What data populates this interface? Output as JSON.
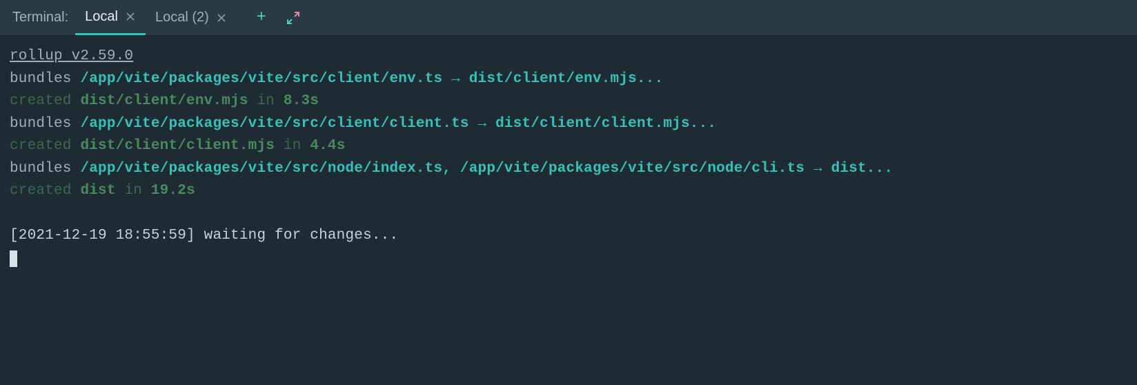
{
  "panel_label": "Terminal:",
  "tabs": [
    {
      "label": "Local",
      "active": true
    },
    {
      "label": "Local (2)",
      "active": false
    }
  ],
  "output": {
    "header": "rollup v2.59.0",
    "lines": [
      {
        "word": "bundles",
        "path": "/app/vite/packages/vite/src/client/env.ts → dist/client/env.mjs..."
      },
      {
        "created_word": "created",
        "out": "dist/client/env.mjs",
        "in_word": " in ",
        "time": "8.3s"
      },
      {
        "word": "bundles",
        "path": "/app/vite/packages/vite/src/client/client.ts → dist/client/client.mjs..."
      },
      {
        "created_word": "created",
        "out": "dist/client/client.mjs",
        "in_word": " in ",
        "time": "4.4s"
      },
      {
        "word": "bundles",
        "path": "/app/vite/packages/vite/src/node/index.ts, /app/vite/packages/vite/src/node/cli.ts → dist..."
      },
      {
        "created_word": "created",
        "out": "dist",
        "in_word": " in ",
        "time": "19.2s"
      }
    ],
    "status": "[2021-12-19 18:55:59] waiting for changes..."
  }
}
